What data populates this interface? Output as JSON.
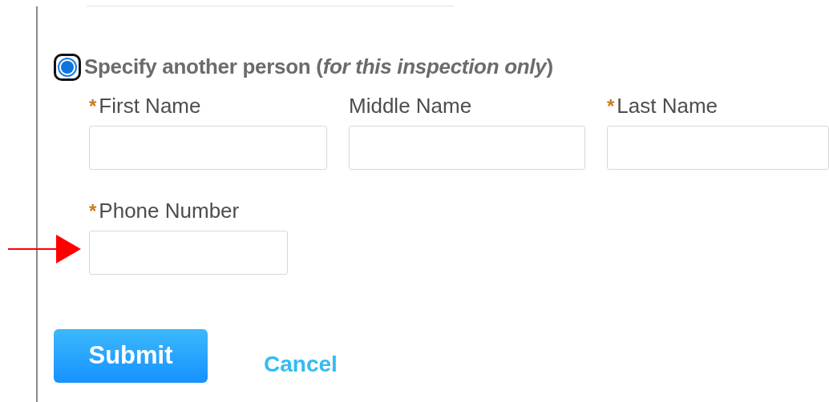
{
  "contact_option": {
    "label": "Specify another person (*for this inspection only*)",
    "selected": true
  },
  "fields": [
    {
      "label": "First Name",
      "required_mark": "*"
    },
    {
      "label": "Middle Name"
    },
    {
      "label": "Last Name",
      "required_mark": "*"
    },
    {
      "label": "Phone Number",
      "required_mark": "*"
    }
  ],
  "buttons": [
    {
      "label": "Submit",
      "kind": "primary"
    },
    {
      "label": "Cancel",
      "kind": "link"
    }
  ]
}
